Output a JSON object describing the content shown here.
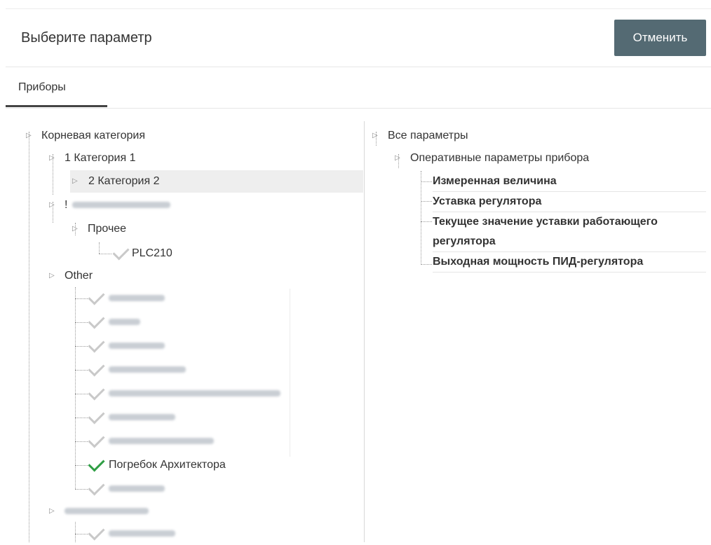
{
  "header": {
    "title": "Выберите параметр",
    "cancel_label": "Отменить"
  },
  "tabs": [
    {
      "label": "Приборы",
      "active": true
    }
  ],
  "left_tree": {
    "root": "Корневая категория",
    "cat1": "1 Категория 1",
    "cat2": "2 Категория 2",
    "blurred_category_prefix": "!",
    "other_group": "Прочее",
    "plc": "PLC210",
    "other": "Other",
    "pogrebok": "Погребок Архитектора"
  },
  "right_tree": {
    "root": "Все параметры",
    "group": "Оперативные параметры прибора",
    "params": [
      "Измеренная величина",
      "Уставка регулятора",
      "Текущее значение уставки работающего регулятора",
      "Выходная мощность ПИД-регулятора"
    ]
  },
  "colors": {
    "button": "#546a73",
    "check": "#2f9e44",
    "selected_row": "#eeeeee"
  }
}
